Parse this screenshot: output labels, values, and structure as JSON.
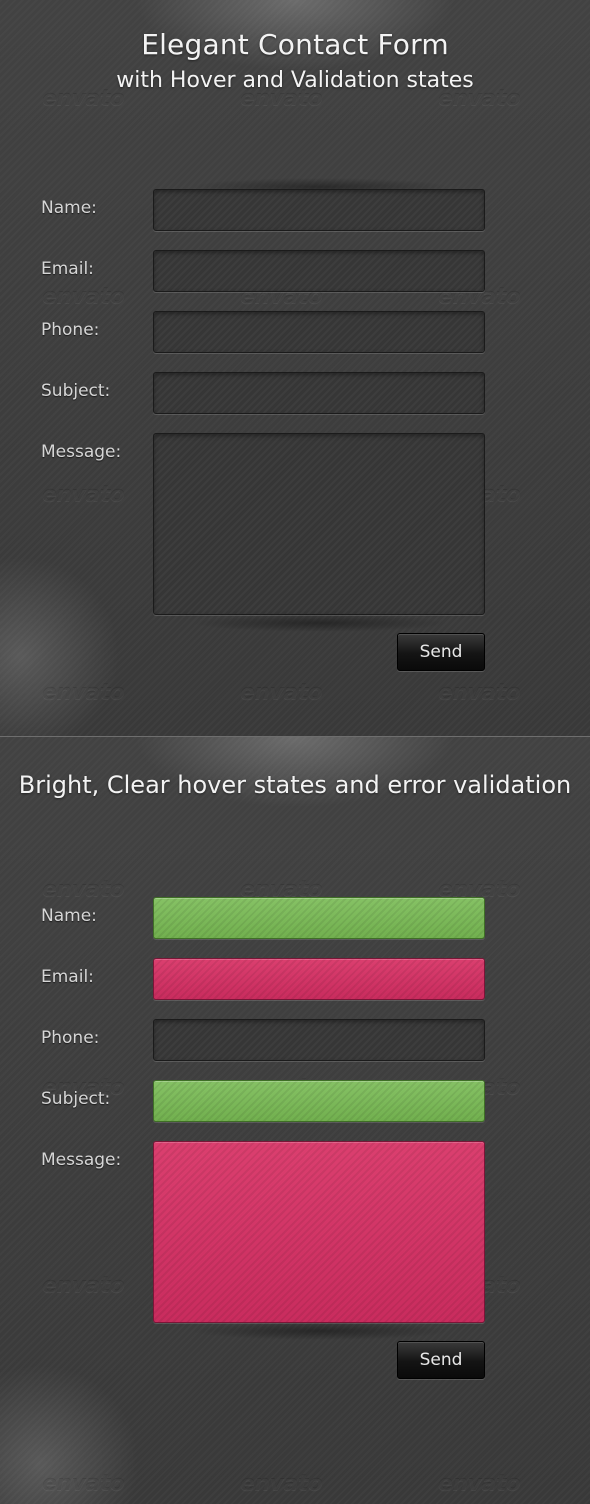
{
  "watermark_text": "envato",
  "top_panel": {
    "title": "Elegant Contact Form",
    "subtitle": "with Hover and Validation states",
    "form": {
      "name_label": "Name:",
      "email_label": "Email:",
      "phone_label": "Phone:",
      "subject_label": "Subject:",
      "message_label": "Message:",
      "send_label": "Send"
    }
  },
  "bottom_panel": {
    "title": "Bright, Clear hover states and error validation",
    "form": {
      "name_label": "Name:",
      "email_label": "Email:",
      "phone_label": "Phone:",
      "subject_label": "Subject:",
      "message_label": "Message:",
      "send_label": "Send"
    },
    "field_states": {
      "name": "valid",
      "email": "error",
      "phone": "default",
      "subject": "valid",
      "message": "error"
    }
  },
  "colors": {
    "background": "#3a3a3a",
    "valid_green": "#7bb858",
    "error_pink": "#d3356a",
    "button_black": "#141414"
  }
}
